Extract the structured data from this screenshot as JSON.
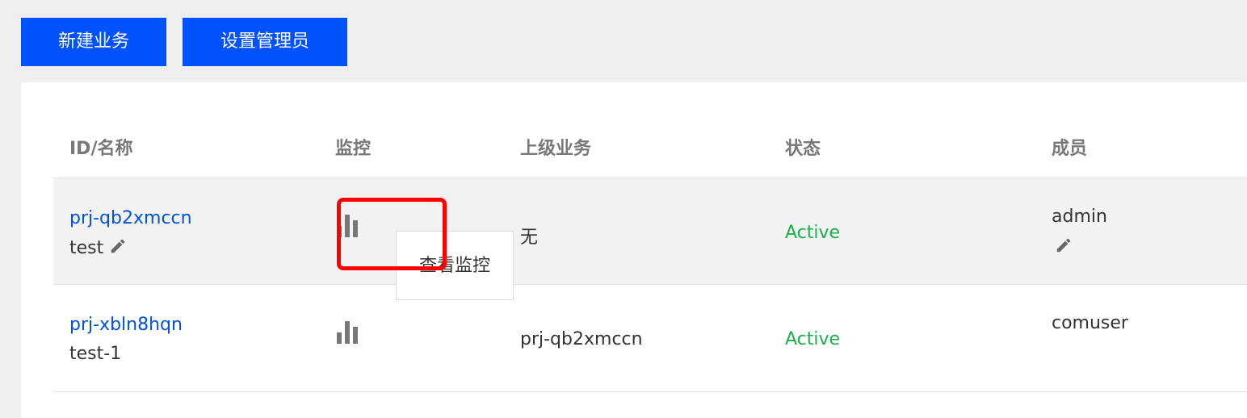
{
  "toolbar": {
    "new_button": "新建业务",
    "admin_button": "设置管理员"
  },
  "table": {
    "headers": {
      "id_name": "ID/名称",
      "monitor": "监控",
      "parent": "上级业务",
      "status": "状态",
      "members": "成员"
    },
    "rows": [
      {
        "id": "prj-qb2xmccn",
        "name": "test",
        "parent": "无",
        "status": "Active",
        "members": "admin"
      },
      {
        "id": "prj-xbln8hqn",
        "name": "test-1",
        "parent": "prj-qb2xmccn",
        "status": "Active",
        "members": "comuser"
      }
    ]
  },
  "tooltip": {
    "text": "查看监控"
  },
  "icons": {
    "monitor": "bar-chart-icon",
    "edit": "pencil-icon"
  },
  "colors": {
    "primary": "#0052ff",
    "link": "#0052d9",
    "active": "#1ab04a",
    "highlight": "#ff0000"
  }
}
